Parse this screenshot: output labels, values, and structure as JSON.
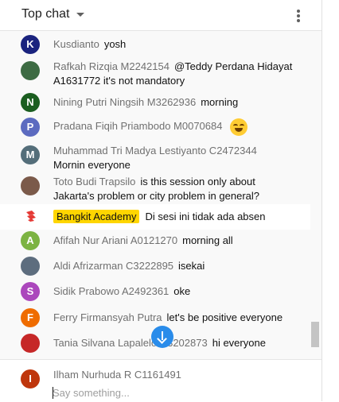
{
  "header": {
    "title": "Top chat"
  },
  "messages": [
    {
      "author": "Kusdianto",
      "text": "yosh",
      "avatar": "K",
      "avatar_color": "#1a237e"
    },
    {
      "author": "Rafkah Rizqia M2242154",
      "text": "@Teddy Perdana Hidayat A1631772 it's not mandatory",
      "avatar": "",
      "avatar_color": "#3d6b43"
    },
    {
      "author": "Nining Putri Ningsih M3262936",
      "text": "morning",
      "avatar": "N",
      "avatar_color": "#1b5e20"
    },
    {
      "author": "Pradana Fiqih Priambodo M0070684",
      "text": "",
      "emoji": "grinning-squinting-face",
      "avatar": "P",
      "avatar_color": "#5c6bc0"
    },
    {
      "author": "Muhammad Tri Madya Lestiyanto C2472344",
      "text": "Mornin everyone",
      "avatar": "M",
      "avatar_color": "#546e7a"
    },
    {
      "author": "Toto Budi Trapsilo",
      "text": "is this session only about Jakarta's problem or city problem in general?",
      "avatar": "",
      "avatar_color": "#7b5a4a"
    },
    {
      "author": "Bangkit Academy",
      "text": "Di sesi ini tidak ada absen",
      "avatar": "",
      "avatar_color": "#e53935",
      "pinned": true
    },
    {
      "author": "Afifah Nur Ariani A0121270",
      "text": "morning all",
      "avatar": "A",
      "avatar_color": "#7cb342"
    },
    {
      "author": "Aldi Afrizarman C3222895",
      "text": "isekai",
      "avatar": "",
      "avatar_color": "#5d6d7e"
    },
    {
      "author": "Sidik Prabowo A2492361",
      "text": "oke",
      "avatar": "S",
      "avatar_color": "#ab47bc"
    },
    {
      "author": "Ferry Firmansyah Putra",
      "text": "let's be positive everyone",
      "avatar": "F",
      "avatar_color": "#ef6c00"
    },
    {
      "author": "Tania Silvana Lapalelo C3202873",
      "text": "hi everyone",
      "avatar": "",
      "avatar_color": "#c62828"
    }
  ],
  "composer": {
    "author": "Ilham Nurhuda R C1161491",
    "avatar": "I",
    "avatar_color": "#bf360c",
    "placeholder": "Say something..."
  },
  "icons": {
    "header_menu": "caret-down-icon",
    "more": "more-vert-icon",
    "jump": "arrow-down-icon"
  }
}
